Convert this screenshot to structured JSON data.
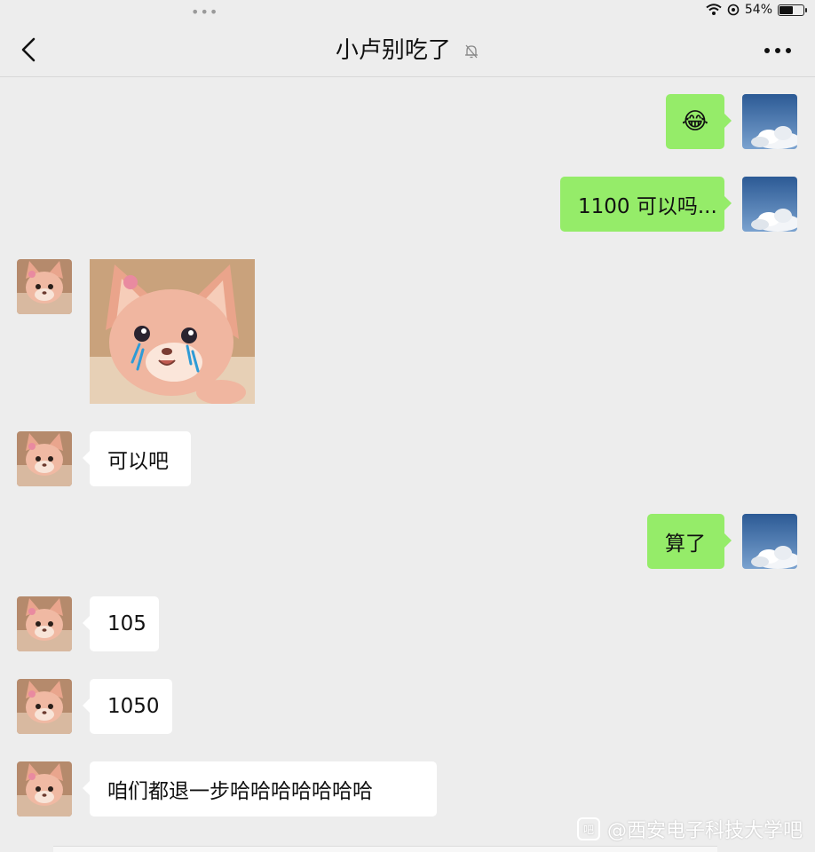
{
  "status_bar": {
    "battery_text": "54%",
    "battery_level": 0.54
  },
  "header": {
    "title": "小卢别吃了"
  },
  "messages": [
    {
      "sender": "me",
      "type": "emoji",
      "emoji": "😂"
    },
    {
      "sender": "me",
      "type": "text",
      "text": "1100 可以吗..."
    },
    {
      "sender": "them",
      "type": "sticker",
      "sticker": "crying-plush-fox"
    },
    {
      "sender": "them",
      "type": "text",
      "text": "可以吧"
    },
    {
      "sender": "me",
      "type": "text",
      "text": "算了"
    },
    {
      "sender": "them",
      "type": "text",
      "text": "105"
    },
    {
      "sender": "them",
      "type": "text",
      "text": "1050"
    },
    {
      "sender": "them",
      "type": "text",
      "text": "咱们都退一步哈哈哈哈哈哈哈"
    }
  ],
  "watermark": {
    "text": "@西安电子科技大学吧"
  },
  "colors": {
    "my_bubble": "#95ec69",
    "their_bubble": "#ffffff",
    "background": "#ededed"
  },
  "icons": [
    "back-arrow-icon",
    "mute-bell-icon",
    "more-dots-icon",
    "wifi-icon",
    "location-icon",
    "battery-icon"
  ]
}
